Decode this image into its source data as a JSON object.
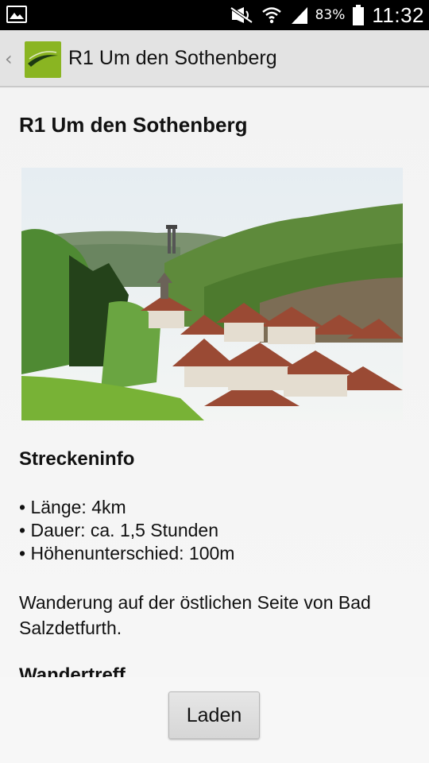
{
  "status_bar": {
    "battery_percent": "83%",
    "time": "11:32",
    "icons": [
      "gallery-icon",
      "mute-icon",
      "wifi-icon",
      "signal-icon",
      "battery-icon"
    ]
  },
  "action_bar": {
    "title": "R1 Um den Sothenberg",
    "back_icon": "chevron-left-icon",
    "logo_color": "#8ab522"
  },
  "content": {
    "title": "R1 Um den Sothenberg",
    "image_alt": "village-landscape-photo",
    "route_info_heading": "Streckeninfo",
    "route_info": [
      "Länge: 4km",
      "Dauer: ca. 1,5 Stunden",
      "Höhenunterschied: 100m"
    ],
    "description": "Wanderung auf der östlichen Seite von Bad Salzdetfurth.",
    "next_heading": "Wandertreff"
  },
  "footer": {
    "load_button_label": "Laden"
  }
}
